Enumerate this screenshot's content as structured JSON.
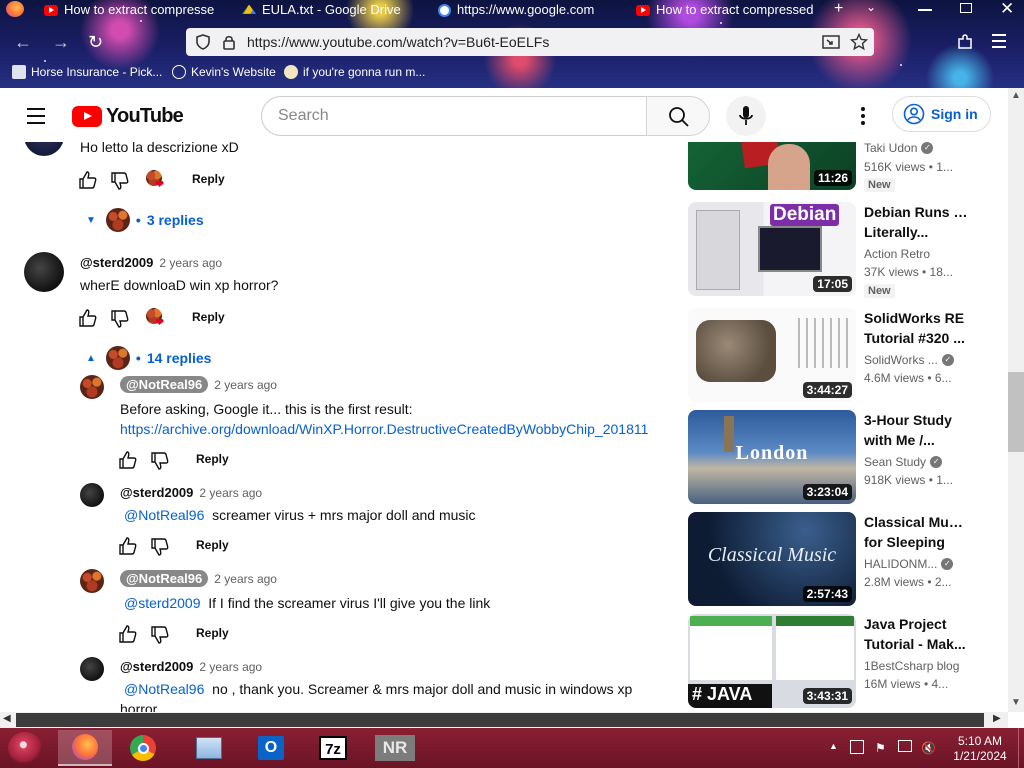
{
  "browser": {
    "tabs": [
      {
        "title": "How to extract compresse",
        "icon": "youtube-icon"
      },
      {
        "title": "EULA.txt - Google Drive",
        "icon": "google-drive-icon"
      },
      {
        "title": "https://www.google.com",
        "icon": "google-icon"
      },
      {
        "title": "How to extract compressed",
        "icon": "youtube-icon"
      }
    ],
    "url": "https://www.youtube.com/watch?v=Bu6t-EoELFs",
    "bookmarks": [
      {
        "label": "Horse Insurance - Pick..."
      },
      {
        "label": "Kevin's Website"
      },
      {
        "label": "if you're gonna run m..."
      }
    ]
  },
  "youtube": {
    "logo_text": "YouTube",
    "search_placeholder": "Search",
    "sign_in": "Sign in"
  },
  "comments": [
    {
      "text": "Ho letto la descrizione xD",
      "reply_label": "Reply",
      "replies_label": "3 replies"
    },
    {
      "author": "@sterd2009",
      "time": "2 years ago",
      "text": "wherE downloaD win xp horror?",
      "reply_label": "Reply",
      "replies_label": "14 replies",
      "replies": [
        {
          "author": "@NotReal96",
          "time": "2 years ago",
          "text": "Before asking, Google it... this is the first result:",
          "link": "https://archive.org/download/WinXP.Horror.DestructiveCreatedByWobbyChip_201811",
          "reply_label": "Reply"
        },
        {
          "author": "@sterd2009",
          "time": "2 years ago",
          "mention": "@NotReal96",
          "text": "screamer virus + mrs major doll and music",
          "reply_label": "Reply"
        },
        {
          "author": "@NotReal96",
          "time": "2 years ago",
          "mention": "@sterd2009",
          "text": "If I find the screamer virus I'll give you the link",
          "reply_label": "Reply"
        },
        {
          "author": "@sterd2009",
          "time": "2 years ago",
          "mention": "@NotReal96",
          "text": "no , thank you. Screamer & mrs major doll and music in windows  xp",
          "text2": "horror"
        }
      ]
    }
  ],
  "sidebar": [
    {
      "duration": "11:26",
      "channel": "Taki Udon",
      "verified": true,
      "meta": "516K views  • 1...",
      "badge": "New"
    },
    {
      "title1": "Debian Runs on",
      "title2": "Literally...",
      "thumb_label": "Debian",
      "duration": "17:05",
      "channel": "Action Retro",
      "verified": false,
      "meta": "37K views  • 18...",
      "badge": "New"
    },
    {
      "title1": "SolidWorks RE",
      "title2": "Tutorial #320 ...",
      "duration": "3:44:27",
      "channel": "SolidWorks ...",
      "verified": true,
      "meta": "4.6M views  • 6..."
    },
    {
      "title1": "3-Hour Study",
      "title2": "with Me /...",
      "thumb_label": "London",
      "duration": "3:23:04",
      "channel": "Sean Study",
      "verified": true,
      "meta": "918K views  • 1..."
    },
    {
      "title1": "Classical Music",
      "title2": "for Sleeping",
      "thumb_label": "Classical Music",
      "duration": "2:57:43",
      "channel": "HALIDONM...",
      "verified": true,
      "meta": "2.8M views  • 2..."
    },
    {
      "title1": "Java Project",
      "title2": "Tutorial - Mak...",
      "thumb_label": "# JAVA",
      "duration": "3:43:31",
      "channel": "1BestCsharp blog",
      "verified": false,
      "meta": "16M views  • 4..."
    }
  ],
  "taskbar": {
    "apps": [
      "firefox",
      "chrome",
      "control-panel",
      "outlook",
      "7zip",
      "nr"
    ],
    "app_labels": {
      "seven_zip": "7z",
      "nr": "NR"
    },
    "time": "5:10 AM",
    "date": "1/21/2024"
  },
  "colors": {
    "youtube_red": "#ff0000",
    "link_blue": "#065fd4",
    "taskbar": "#7a1a2d"
  }
}
